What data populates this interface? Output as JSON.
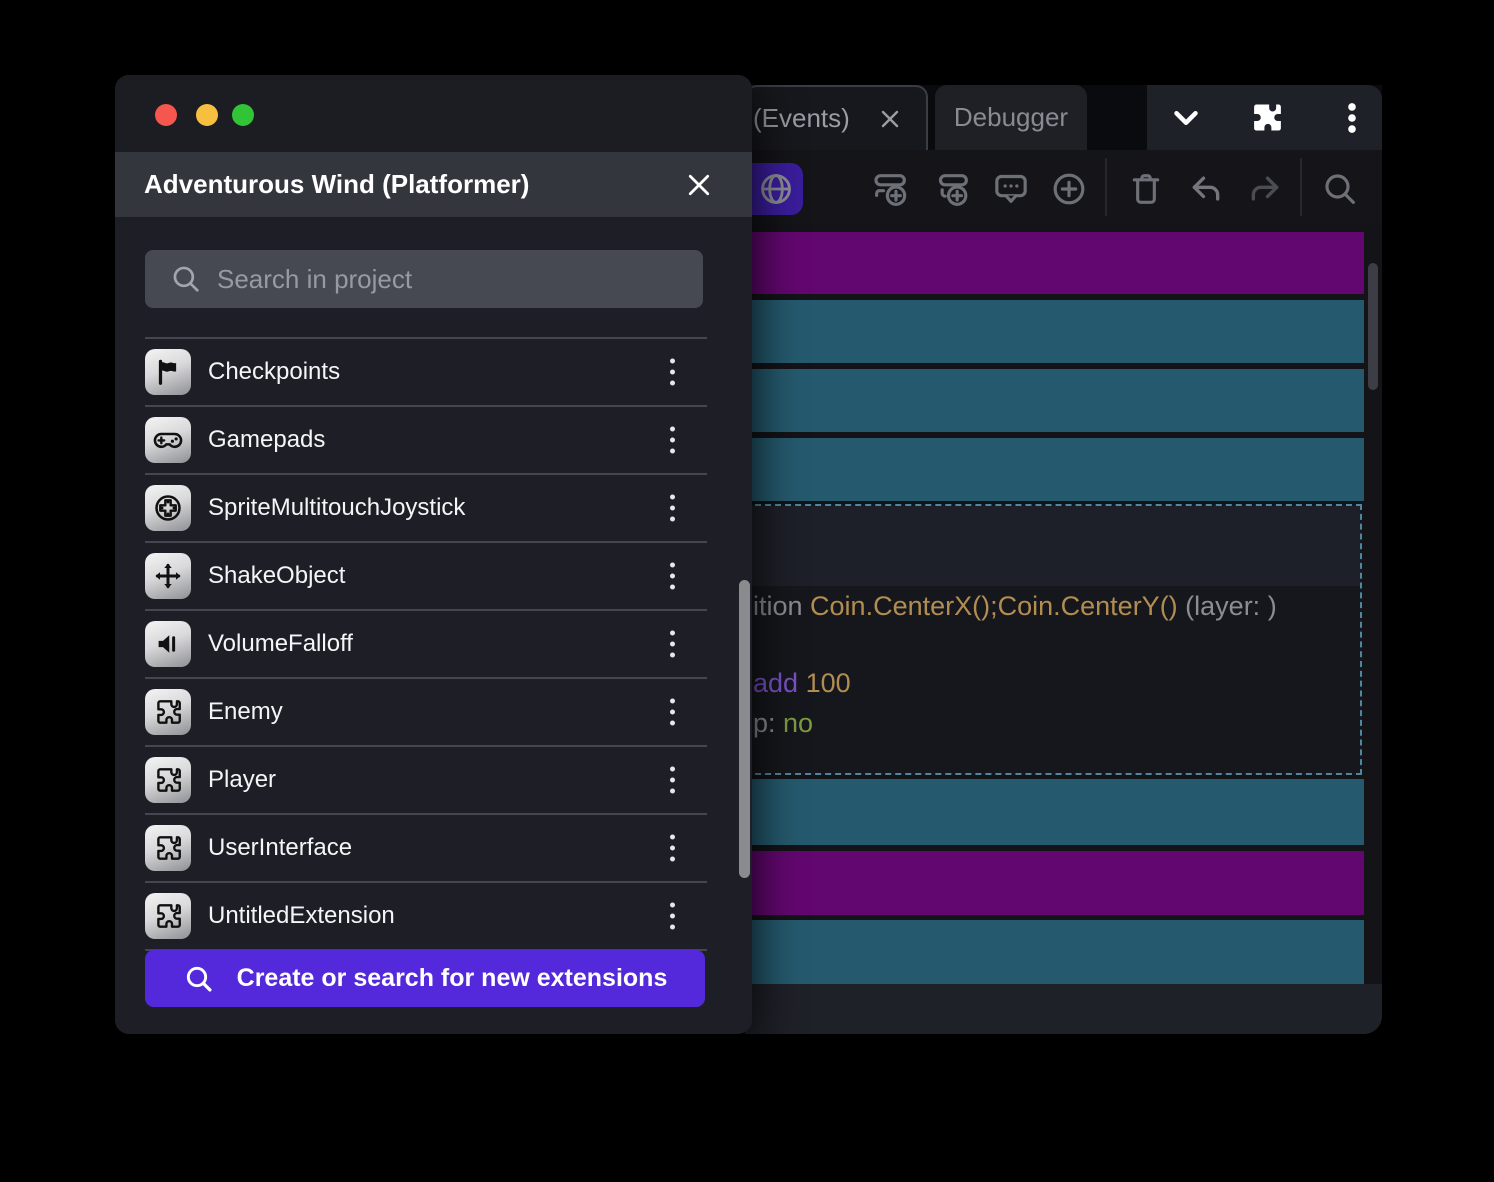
{
  "dialog": {
    "title": "Adventurous Wind (Platformer)",
    "search": {
      "placeholder": "Search in project"
    },
    "items": [
      {
        "label": "Checkpoints",
        "icon": "flag-icon"
      },
      {
        "label": "Gamepads",
        "icon": "gamepad-icon"
      },
      {
        "label": "SpriteMultitouchJoystick",
        "icon": "joystick-icon"
      },
      {
        "label": "ShakeObject",
        "icon": "move-arrows-icon"
      },
      {
        "label": "VolumeFalloff",
        "icon": "speaker-icon"
      },
      {
        "label": "Enemy",
        "icon": "puzzle-icon"
      },
      {
        "label": "Player",
        "icon": "puzzle-icon"
      },
      {
        "label": "UserInterface",
        "icon": "puzzle-icon"
      },
      {
        "label": "UntitledExtension",
        "icon": "puzzle-icon"
      }
    ],
    "create_button": "Create or search for new extensions"
  },
  "editor": {
    "tabs": [
      {
        "label": "(Events)",
        "active": true,
        "closable": true
      },
      {
        "label": "Debugger",
        "active": false
      }
    ],
    "top_icons": [
      "chevron-down-icon",
      "extensions-puzzle-icon",
      "kebab-menu-icon"
    ],
    "toolbar_icons": [
      "globe-icon",
      "add-event-icon",
      "add-subevent-icon",
      "add-comment-icon",
      "add-circle-icon",
      "trash-icon",
      "undo-icon",
      "redo-icon",
      "search-icon"
    ],
    "code": {
      "line1": [
        {
          "text": "ition ",
          "color": "gray"
        },
        {
          "text": "Coin.CenterX();Coin.CenterY()",
          "color": "gold"
        },
        {
          "text": " (layer: )",
          "color": "gray"
        }
      ],
      "line2": [
        {
          "text": "add",
          "color": "purple"
        },
        {
          "text": " 100",
          "color": "gold"
        }
      ],
      "line3": [
        {
          "text": "p: ",
          "color": "gray"
        },
        {
          "text": "no",
          "color": "green"
        }
      ]
    }
  },
  "colors": {
    "accent_purple_button": "#5329db",
    "toolbar_globe_button": "#3a1d9c",
    "event_row_purple": "#630770",
    "event_row_teal": "#255a6e",
    "selection_dashed_border": "#4e87a0",
    "code_gray": "#8b8d94",
    "code_gold": "#b18d51",
    "code_purple": "#7a52c8",
    "code_green": "#7f9c3f",
    "traffic_red": "#f5564d",
    "traffic_yellow": "#f6bf3f",
    "traffic_green": "#32c437"
  }
}
